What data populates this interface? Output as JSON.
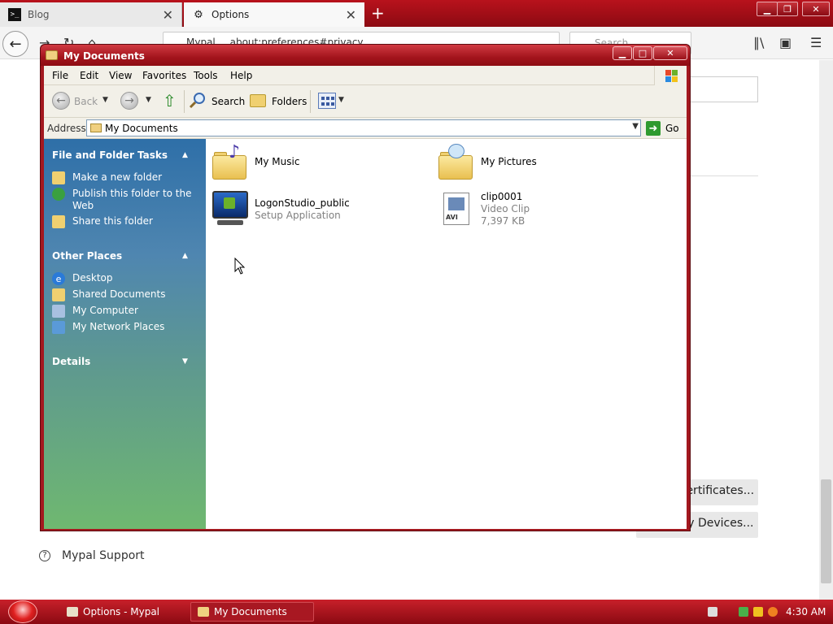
{
  "browser": {
    "tabs": [
      {
        "label": "Blog",
        "active": false
      },
      {
        "label": "Options",
        "active": true
      }
    ],
    "url_prefix": "Mypal",
    "url": "about:preferences#privacy",
    "search_placeholder": "Search",
    "page": {
      "certificates_label": "View Certificates...",
      "devices_label": "Security Devices...",
      "support_label": "Mypal Support"
    }
  },
  "explorer": {
    "title": "My Documents",
    "menu": [
      "File",
      "Edit",
      "View",
      "Favorites",
      "Tools",
      "Help"
    ],
    "toolbar": {
      "back": "Back",
      "search": "Search",
      "folders": "Folders"
    },
    "address": {
      "label": "Address",
      "value": "My Documents",
      "go": "Go"
    },
    "taskpane": {
      "file_tasks": {
        "title": "File and Folder Tasks",
        "items": [
          "Make a new folder",
          "Publish this folder to the Web",
          "Share this folder"
        ]
      },
      "other_places": {
        "title": "Other Places",
        "items": [
          "Desktop",
          "Shared Documents",
          "My Computer",
          "My Network Places"
        ]
      },
      "details": {
        "title": "Details"
      }
    },
    "files": [
      {
        "name": "My Music",
        "type": "folder-music"
      },
      {
        "name": "My Pictures",
        "type": "folder-pictures"
      },
      {
        "name": "LogonStudio_public",
        "sub1": "Setup Application",
        "type": "setup-app"
      },
      {
        "name": "clip0001",
        "sub1": "Video Clip",
        "sub2": "7,397 KB",
        "type": "avi",
        "badge": "AVI"
      }
    ]
  },
  "taskbar": {
    "tasks": [
      {
        "label": "Options - Mypal"
      },
      {
        "label": "My Documents"
      }
    ],
    "clock": "4:30 AM"
  },
  "colors": {
    "accent_red": "#a3181f",
    "pane_top": "#2e6fa8",
    "pane_bottom": "#6fb870"
  }
}
